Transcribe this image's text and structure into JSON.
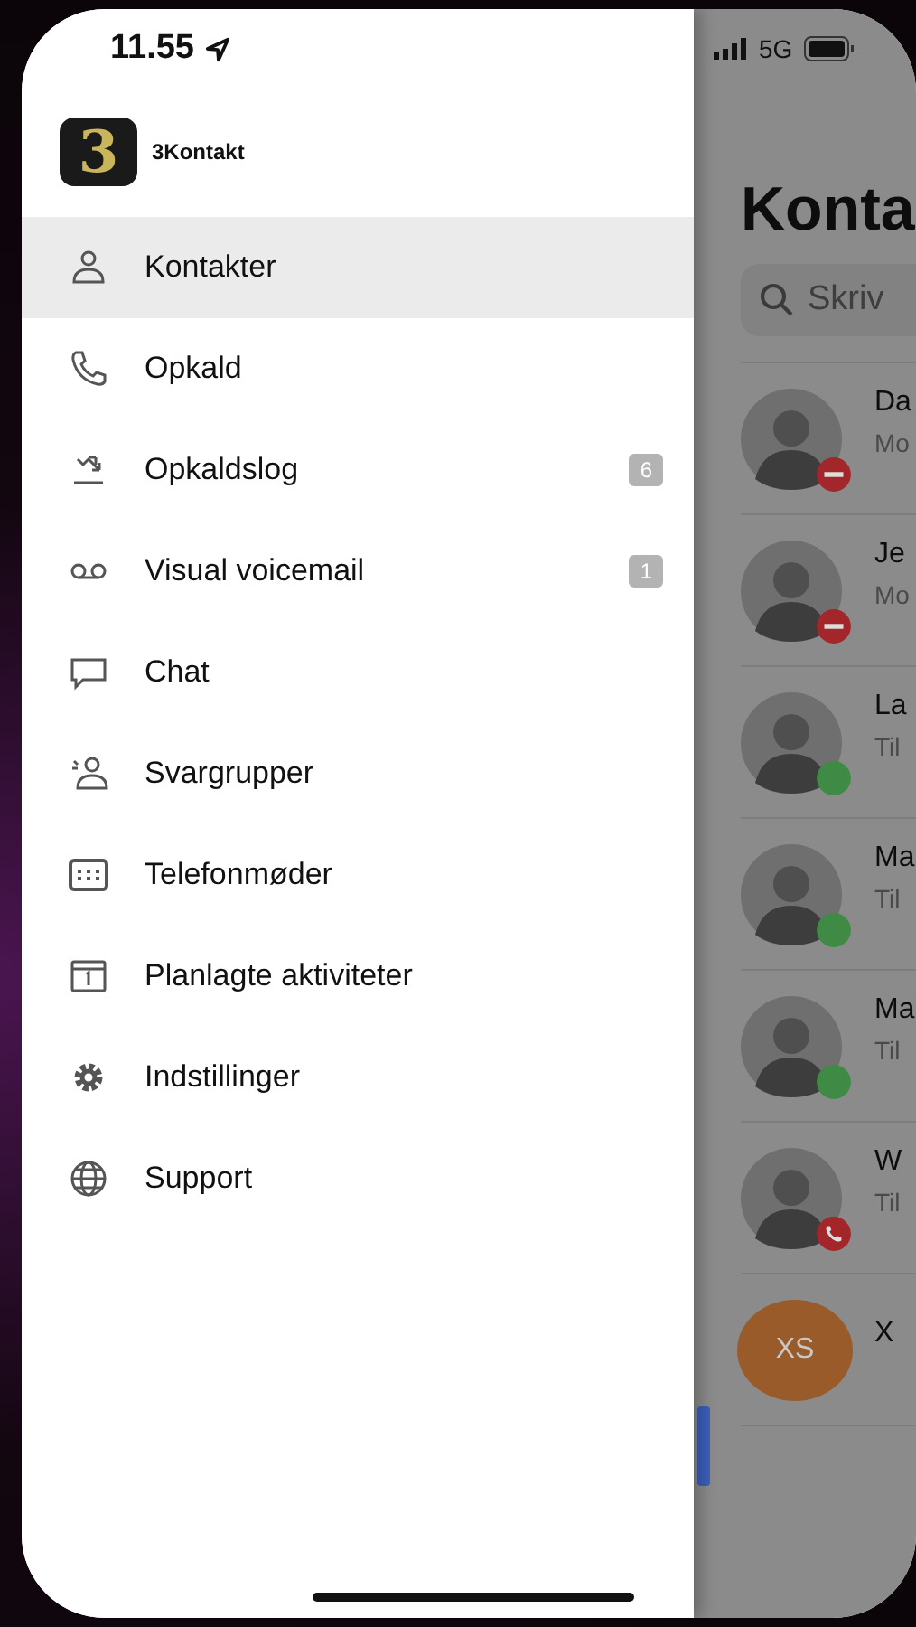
{
  "status_bar": {
    "time": "11.55",
    "network": "5G"
  },
  "app": {
    "logo": "3",
    "name": "3Kontakt"
  },
  "menu": [
    {
      "kind": "person",
      "label": "Kontakter",
      "selected": true
    },
    {
      "kind": "phone",
      "label": "Opkald",
      "selected": false
    },
    {
      "kind": "calllog",
      "label": "Opkaldslog",
      "badge": "6",
      "selected": false
    },
    {
      "kind": "voicemail",
      "label": "Visual voicemail",
      "badge": "1",
      "selected": false
    },
    {
      "kind": "chat",
      "label": "Chat",
      "selected": false
    },
    {
      "kind": "group",
      "label": "Svargrupper",
      "selected": false
    },
    {
      "kind": "grid",
      "label": "Telefonmøder",
      "selected": false
    },
    {
      "kind": "calendar",
      "label": "Planlagte aktiviteter",
      "selected": false
    },
    {
      "kind": "gear",
      "label": "Indstillinger",
      "selected": false
    },
    {
      "kind": "globe",
      "label": "Support",
      "selected": false
    }
  ],
  "contacts_panel": {
    "title": "Konta",
    "search": {
      "placeholder": "Skriv"
    },
    "contacts": [
      {
        "kind": "photo",
        "name": "Da",
        "subtitle": "Mo",
        "status": {
          "kind": "busy",
          "color": "#a3262b"
        }
      },
      {
        "kind": "photo",
        "name": "Je",
        "subtitle": "Mo",
        "status": {
          "kind": "busy",
          "color": "#a3262b"
        }
      },
      {
        "kind": "photo",
        "name": "La",
        "subtitle": "Til",
        "status": {
          "kind": "available",
          "color": "#3f8a45"
        }
      },
      {
        "kind": "photo",
        "name": "Ma",
        "subtitle": "Til",
        "status": {
          "kind": "available",
          "color": "#3f8a45"
        }
      },
      {
        "kind": "photo",
        "name": "Ma",
        "subtitle": "Til",
        "status": {
          "kind": "available",
          "color": "#3f8a45"
        }
      },
      {
        "kind": "photo",
        "name": "W",
        "subtitle": "Til",
        "status": {
          "kind": "call",
          "color": "#a3262b"
        }
      },
      {
        "kind": "initials",
        "initials": "XS",
        "name": "X"
      }
    ]
  }
}
